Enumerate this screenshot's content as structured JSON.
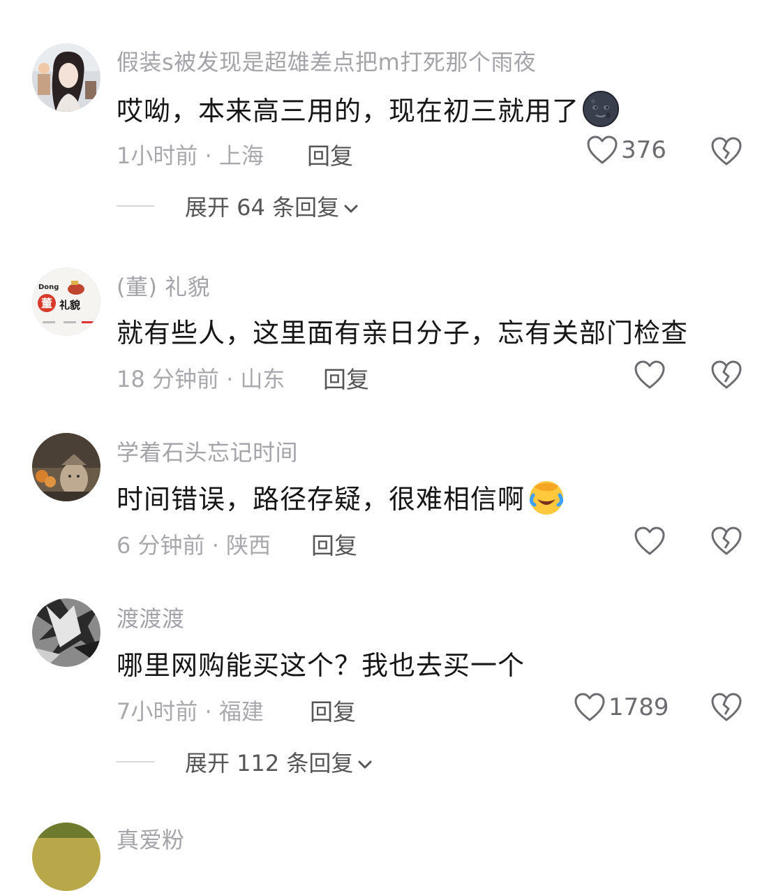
{
  "comments": [
    {
      "username": "假装s被发现是超雄差点把m打死那个雨夜",
      "text": "哎呦，本来高三用的，现在初三就用了",
      "emoji": "new-moon-face-emoji",
      "meta": "1小时前 · 上海",
      "reply_label": "回复",
      "likes": "376",
      "expand_label": "展开 64 条回复"
    },
    {
      "username": "(董) 礼貌",
      "text": "就有些人，这里面有亲日分子，忘有关部门检查",
      "meta": "18 分钟前 · 山东",
      "reply_label": "回复",
      "likes": ""
    },
    {
      "username": "学着石头忘记时间",
      "text": "时间错误，路径存疑，很难相信啊",
      "emoji": "face-palm-crying-emoji",
      "meta": "6 分钟前 · 陕西",
      "reply_label": "回复",
      "likes": ""
    },
    {
      "username": "渡渡渡",
      "text": "哪里网购能买这个？我也去买一个",
      "meta": "7小时前 · 福建",
      "reply_label": "回复",
      "likes": "1789",
      "expand_label": "展开 112 条回复"
    },
    {
      "username": "真爱粉"
    }
  ],
  "avatar_badges": {
    "dong_latin": "Dong",
    "dong_char": "董",
    "dong_text": "礼貌"
  },
  "icons": {
    "like": "heart-outline-icon",
    "dislike": "broken-heart-icon",
    "expand": "chevron-down-icon"
  },
  "colors": {
    "username": "#a3a3a8",
    "content": "#161616",
    "meta": "#a8a8ad",
    "reply": "#555555",
    "icon": "#6b6b70"
  }
}
